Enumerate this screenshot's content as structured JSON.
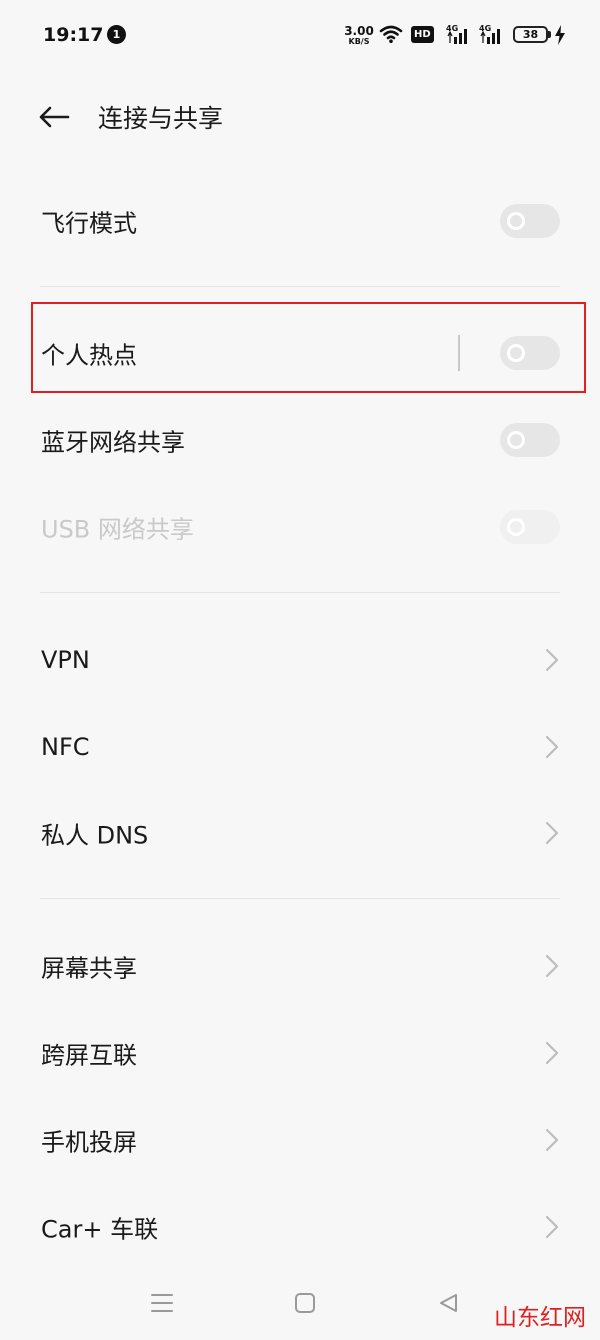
{
  "status_bar": {
    "time": "19:17",
    "notification_count": "1",
    "net_speed_value": "3.00",
    "net_speed_unit": "KB/S",
    "hd_label": "HD",
    "signal1_label": "4G",
    "signal2_label": "4G",
    "battery_level": "38"
  },
  "header": {
    "back_icon": "arrow-left-icon",
    "title": "连接与共享"
  },
  "rows": {
    "airplane": {
      "label": "飞行模式",
      "enabled": false
    },
    "hotspot": {
      "label": "个人热点",
      "enabled": false
    },
    "bluetooth_tether": {
      "label": "蓝牙网络共享",
      "enabled": false
    },
    "usb_tether": {
      "label": "USB 网络共享",
      "enabled": false,
      "disabled": true
    },
    "vpn": {
      "label": "VPN"
    },
    "nfc": {
      "label": "NFC"
    },
    "private_dns": {
      "label": "私人 DNS"
    },
    "screen_share": {
      "label": "屏幕共享"
    },
    "cross_screen": {
      "label": "跨屏互联"
    },
    "phone_cast": {
      "label": "手机投屏"
    },
    "car_link": {
      "label": "Car+ 车联"
    }
  },
  "nav_bar": {
    "icons": [
      "menu-icon",
      "home-square-icon",
      "back-triangle-icon"
    ]
  },
  "watermark": "山东红网",
  "colors": {
    "background": "#f7f7f7",
    "highlight": "#e02020",
    "toggle_off": "#e6e6e6"
  }
}
